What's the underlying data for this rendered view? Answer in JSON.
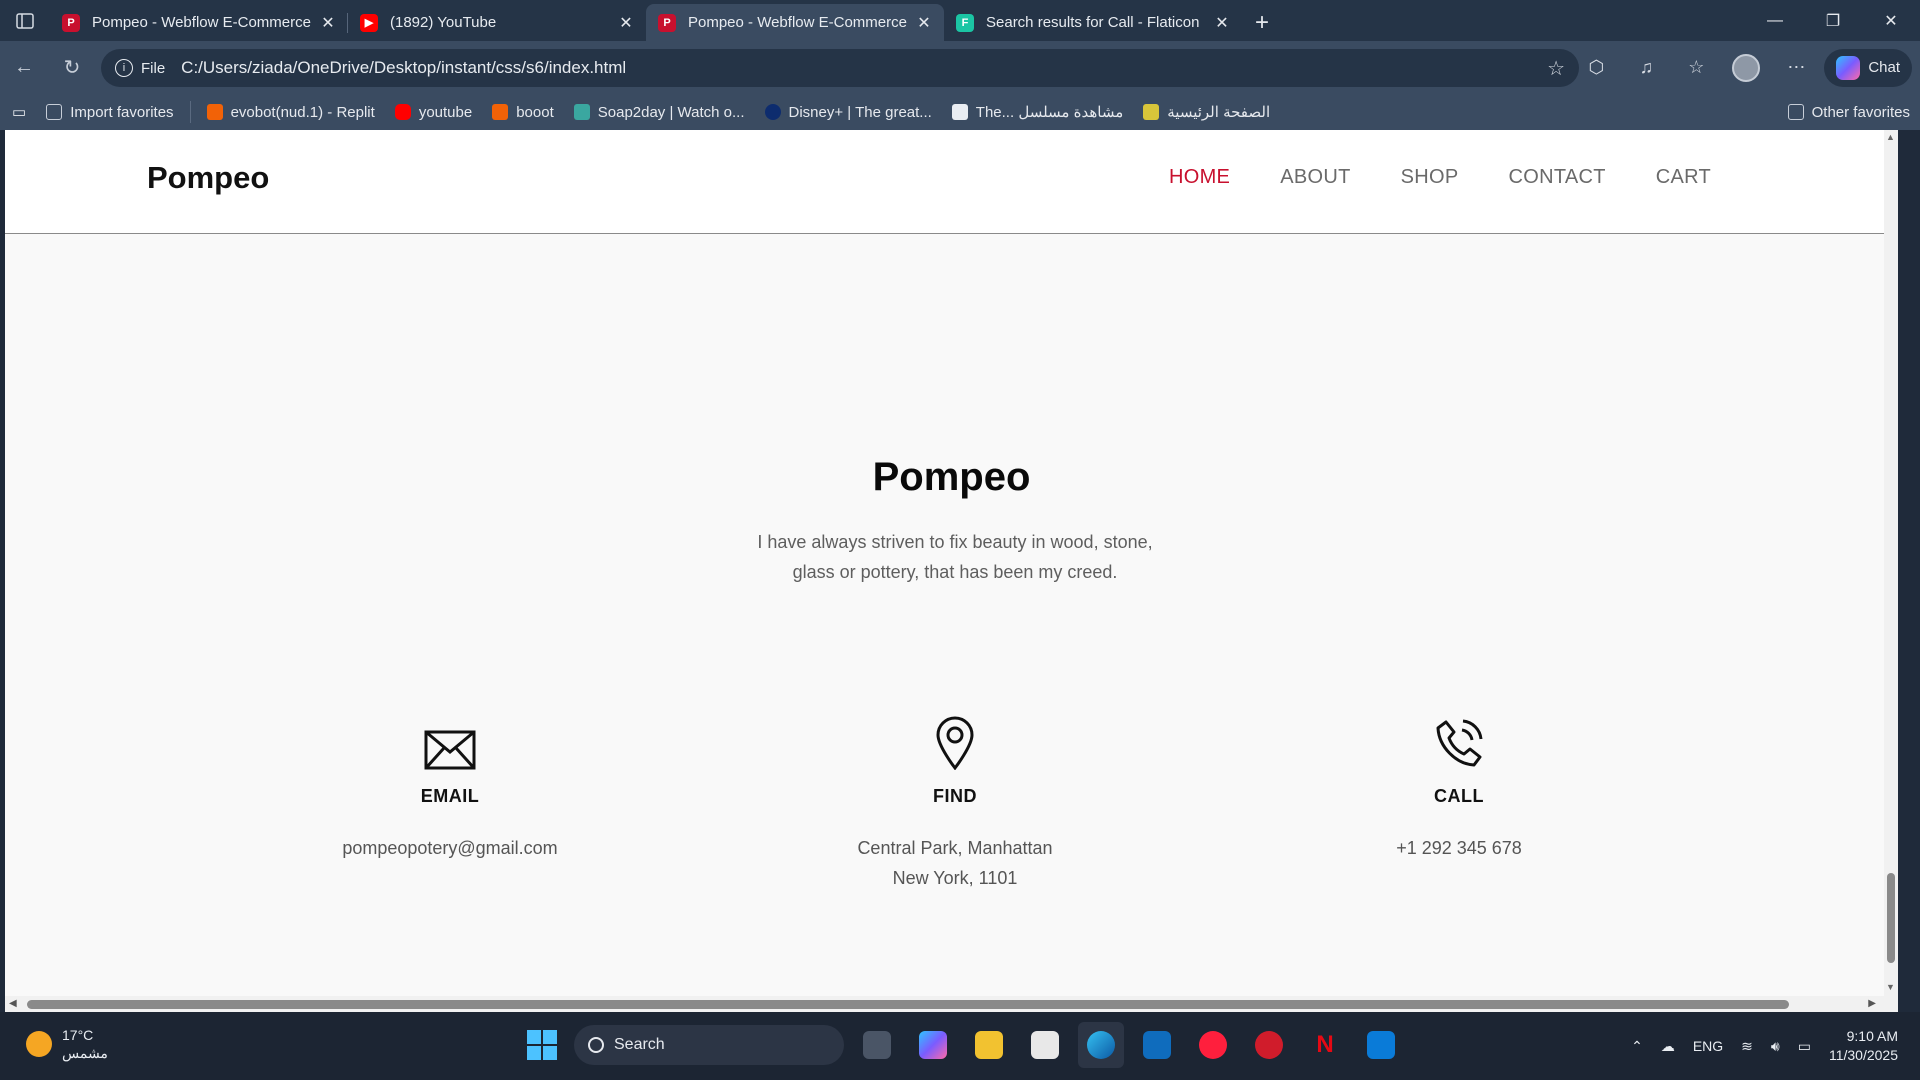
{
  "browser": {
    "tabs": [
      {
        "title": "Pompeo - Webflow E-Commerce",
        "favicon_color": "#c8102e",
        "active": false
      },
      {
        "title": "(1892) YouTube",
        "favicon_color": "#ff0000",
        "active": false
      },
      {
        "title": "Pompeo - Webflow E-Commerce",
        "favicon_color": "#c8102e",
        "active": true
      },
      {
        "title": "Search results for Call - Flaticon",
        "favicon_color": "#1bc5a4",
        "active": false
      }
    ],
    "address": {
      "protocol": "File",
      "url": "C:/Users/ziada/OneDrive/Desktop/instant/css/s6/index.html"
    },
    "copilot_label": "Chat",
    "bookmarks": [
      {
        "label": "Import favorites",
        "color": "#c7ced8"
      },
      {
        "label": "evobot(nud.1) - Replit",
        "color": "#f26207"
      },
      {
        "label": "youtube",
        "color": "#ff0000"
      },
      {
        "label": "booot",
        "color": "#f26207"
      },
      {
        "label": "Soap2day | Watch o...",
        "color": "#3aa7a0"
      },
      {
        "label": "Disney+ | The great...",
        "color": "#0d2c6e"
      },
      {
        "label": "The... مشاهدة مسلسل",
        "color": "#e9edf2"
      },
      {
        "label": "الصفحة الرئيسية",
        "color": "#d8c53a"
      }
    ],
    "other_favorites": "Other favorites"
  },
  "site": {
    "brand": "Pompeo",
    "nav": [
      {
        "label": "HOME",
        "active": true
      },
      {
        "label": "ABOUT",
        "active": false
      },
      {
        "label": "SHOP",
        "active": false
      },
      {
        "label": "CONTACT",
        "active": false
      },
      {
        "label": "CART",
        "active": false
      }
    ],
    "accent_color": "#c8102e",
    "hero": {
      "title": "Pompeo",
      "text_line1": "I have always striven to fix beauty in wood, stone,",
      "text_line2": "glass or pottery, that has been my creed."
    },
    "contacts": [
      {
        "icon": "envelope-icon",
        "label": "EMAIL",
        "line1": "pompeopotery@gmail.com",
        "line2": ""
      },
      {
        "icon": "map-pin-icon",
        "label": "FIND",
        "line1": "Central Park, Manhattan",
        "line2": "New York, 1101"
      },
      {
        "icon": "phone-call-icon",
        "label": "CALL",
        "line1": "+1 292 345 678",
        "line2": ""
      }
    ]
  },
  "taskbar": {
    "weather_temp": "17°C",
    "weather_desc": "مشمس",
    "search_placeholder": "Search",
    "language": "ENG",
    "time": "9:10 AM",
    "date": "11/30/2025"
  }
}
